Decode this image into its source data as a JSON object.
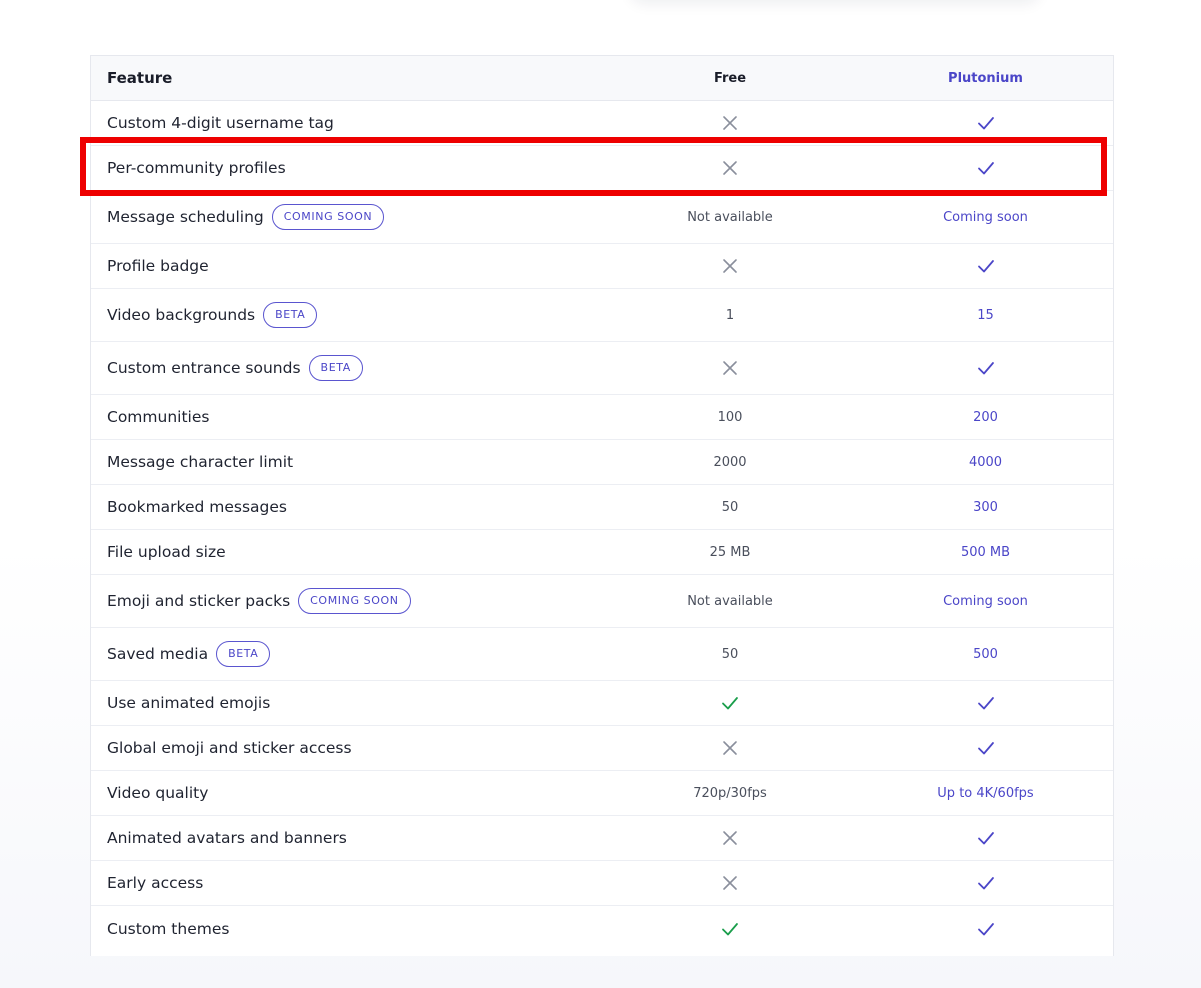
{
  "table": {
    "headers": {
      "feature": "Feature",
      "free": "Free",
      "plutonium": "Plutonium"
    },
    "rows": [
      {
        "feature": "Custom 4-digit username tag",
        "badge": null,
        "free": {
          "kind": "cross"
        },
        "plutonium": {
          "kind": "check"
        }
      },
      {
        "feature": "Per-community profiles",
        "badge": null,
        "free": {
          "kind": "cross"
        },
        "plutonium": {
          "kind": "check"
        }
      },
      {
        "feature": "Message scheduling",
        "badge": "COMING SOON",
        "free": {
          "kind": "text",
          "value": "Not available"
        },
        "plutonium": {
          "kind": "text",
          "value": "Coming soon"
        }
      },
      {
        "feature": "Profile badge",
        "badge": null,
        "free": {
          "kind": "cross"
        },
        "plutonium": {
          "kind": "check"
        }
      },
      {
        "feature": "Video backgrounds",
        "badge": "BETA",
        "free": {
          "kind": "text",
          "value": "1"
        },
        "plutonium": {
          "kind": "text",
          "value": "15"
        }
      },
      {
        "feature": "Custom entrance sounds",
        "badge": "BETA",
        "free": {
          "kind": "cross"
        },
        "plutonium": {
          "kind": "check"
        }
      },
      {
        "feature": "Communities",
        "badge": null,
        "free": {
          "kind": "text",
          "value": "100"
        },
        "plutonium": {
          "kind": "text",
          "value": "200"
        }
      },
      {
        "feature": "Message character limit",
        "badge": null,
        "free": {
          "kind": "text",
          "value": "2000"
        },
        "plutonium": {
          "kind": "text",
          "value": "4000"
        }
      },
      {
        "feature": "Bookmarked messages",
        "badge": null,
        "free": {
          "kind": "text",
          "value": "50"
        },
        "plutonium": {
          "kind": "text",
          "value": "300"
        }
      },
      {
        "feature": "File upload size",
        "badge": null,
        "free": {
          "kind": "text",
          "value": "25 MB"
        },
        "plutonium": {
          "kind": "text",
          "value": "500 MB"
        }
      },
      {
        "feature": "Emoji and sticker packs",
        "badge": "COMING SOON",
        "free": {
          "kind": "text",
          "value": "Not available"
        },
        "plutonium": {
          "kind": "text",
          "value": "Coming soon"
        }
      },
      {
        "feature": "Saved media",
        "badge": "BETA",
        "free": {
          "kind": "text",
          "value": "50"
        },
        "plutonium": {
          "kind": "text",
          "value": "500"
        }
      },
      {
        "feature": "Use animated emojis",
        "badge": null,
        "free": {
          "kind": "check-green"
        },
        "plutonium": {
          "kind": "check"
        }
      },
      {
        "feature": "Global emoji and sticker access",
        "badge": null,
        "free": {
          "kind": "cross"
        },
        "plutonium": {
          "kind": "check"
        }
      },
      {
        "feature": "Video quality",
        "badge": null,
        "free": {
          "kind": "text",
          "value": "720p/30fps"
        },
        "plutonium": {
          "kind": "text",
          "value": "Up to 4K/60fps"
        }
      },
      {
        "feature": "Animated avatars and banners",
        "badge": null,
        "free": {
          "kind": "cross"
        },
        "plutonium": {
          "kind": "check"
        }
      },
      {
        "feature": "Early access",
        "badge": null,
        "free": {
          "kind": "cross"
        },
        "plutonium": {
          "kind": "check"
        }
      },
      {
        "feature": "Custom themes",
        "badge": null,
        "free": {
          "kind": "check-green"
        },
        "plutonium": {
          "kind": "check"
        }
      }
    ]
  },
  "icons": {
    "cross": "x-icon",
    "check": "checkmark-icon",
    "check-green": "checkmark-icon"
  },
  "colors": {
    "accent": "#4b46c8",
    "check_purple": "#4b46c8",
    "check_green": "#1a9e4b",
    "cross_gray": "#8a8f9c",
    "highlight_red": "#ee0000"
  },
  "highlight": {
    "row_index": 1
  }
}
